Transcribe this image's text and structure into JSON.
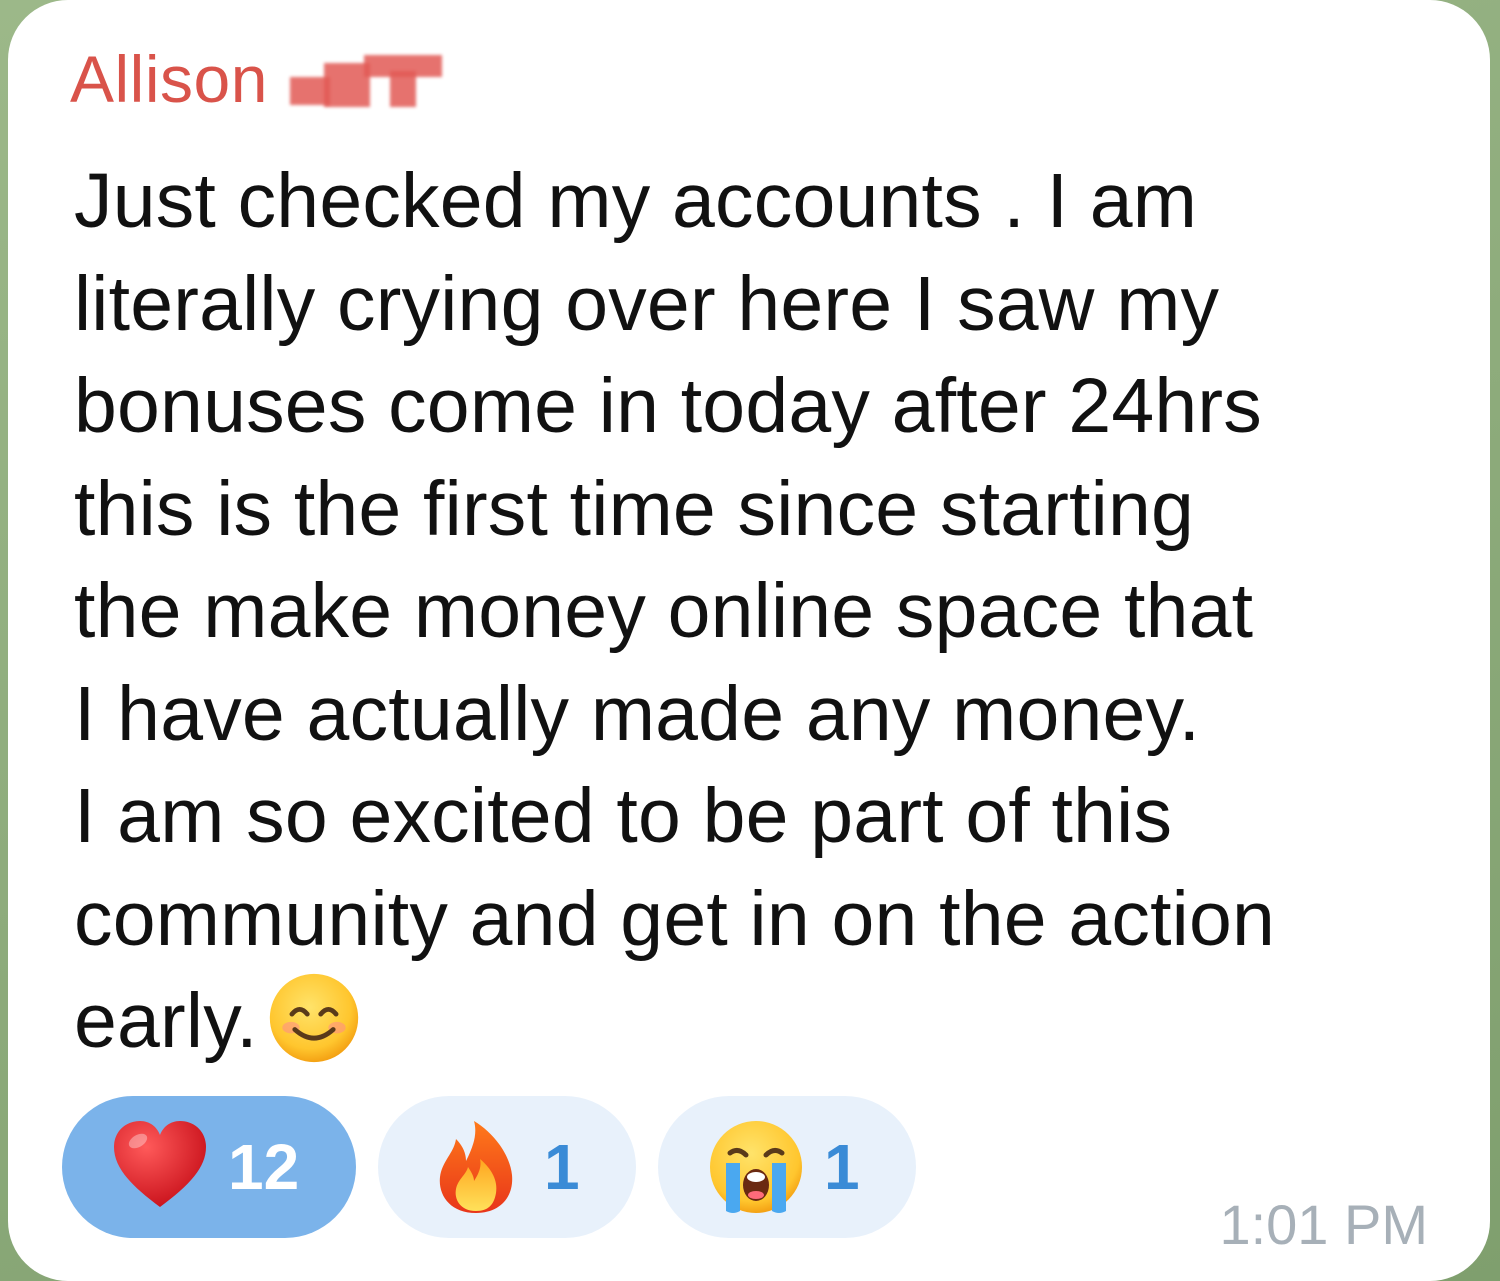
{
  "message": {
    "sender": "Allison",
    "text_lines": [
      "Just checked my accounts . I am",
      "literally crying over here I saw my",
      "bonuses come in today after 24hrs",
      "this is the first time since starting",
      "the make money online space that",
      "I have actually made any money.",
      "I am so excited to be part of this",
      "community and get in on the action",
      "early."
    ],
    "trailing_emoji": "smiling-face-with-smiling-eyes-icon",
    "time": "1:01 PM"
  },
  "reactions": [
    {
      "emoji": "red-heart-icon",
      "count": "12",
      "selected": true
    },
    {
      "emoji": "fire-icon",
      "count": "1",
      "selected": false
    },
    {
      "emoji": "loudly-crying-face-icon",
      "count": "1",
      "selected": false
    }
  ],
  "colors": {
    "sender": "#d9534a",
    "selected_reaction_bg": "#7bb3ea",
    "reaction_bg": "#e8f1fb",
    "reaction_count": "#3a8bd6",
    "timestamp": "#a7b0b8"
  }
}
